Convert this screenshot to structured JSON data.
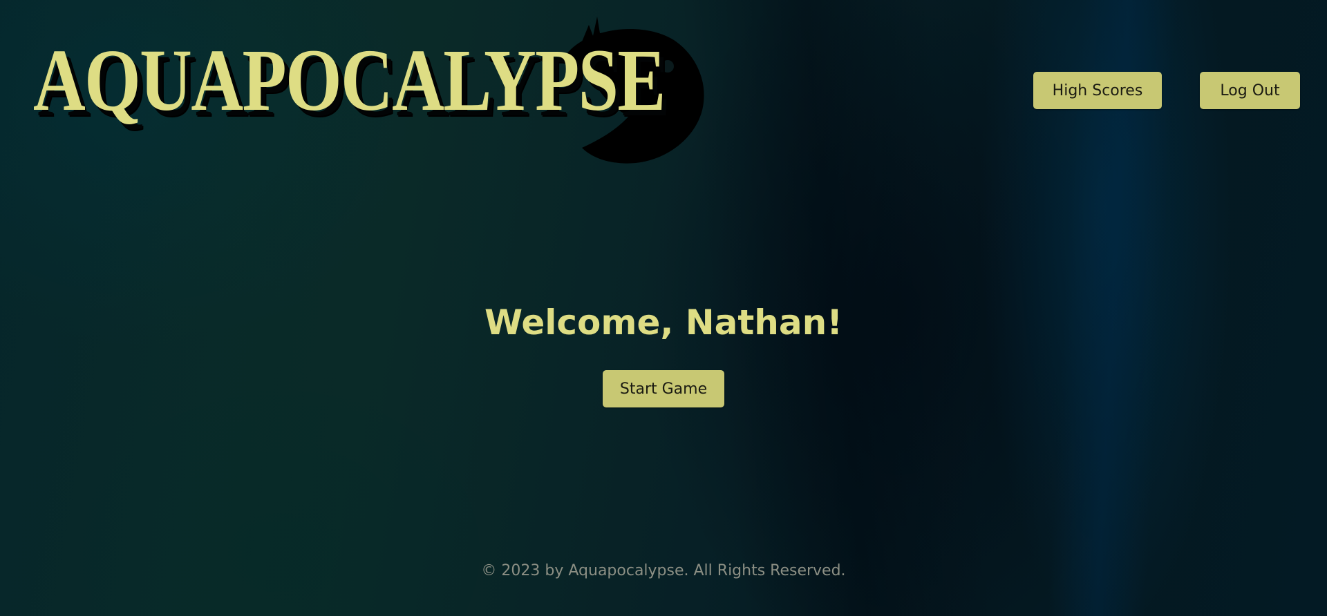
{
  "header": {
    "logo_text": "AQUAPOCALYPSE",
    "high_scores_label": "High Scores",
    "log_out_label": "Log Out"
  },
  "main": {
    "welcome_text": "Welcome, Nathan!",
    "start_game_label": "Start Game"
  },
  "footer": {
    "copyright": "© 2023 by Aquapocalypse. All Rights Reserved."
  },
  "colors": {
    "accent_text": "#dedd84",
    "button_bg": "#c8c873",
    "button_text": "#1b1b12",
    "footer_text": "#8c8f84",
    "background_dark": "#06242a"
  },
  "icons": {
    "logo_mascot": "piranha-fish-silhouette"
  }
}
